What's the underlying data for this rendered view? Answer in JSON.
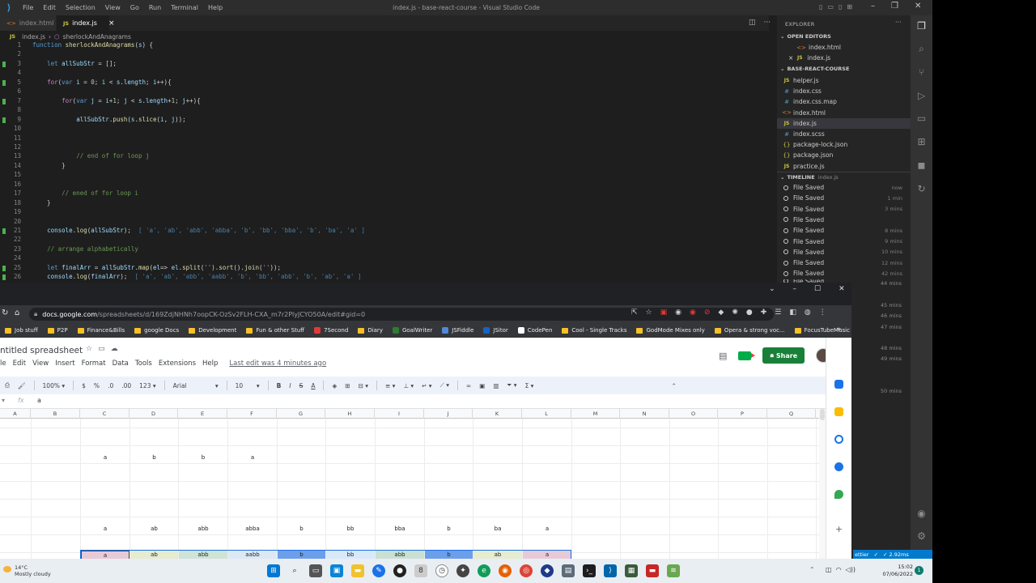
{
  "vscode": {
    "menus": [
      "File",
      "Edit",
      "Selection",
      "View",
      "Go",
      "Run",
      "Terminal",
      "Help"
    ],
    "window_title": "index.js - base-react-course - Visual Studio Code",
    "tabs": [
      {
        "label": "index.html",
        "icon": "html-file-icon",
        "active": false
      },
      {
        "label": "index.js",
        "icon": "js-file-icon",
        "active": true
      }
    ],
    "tab_close": "×",
    "breadcrumb": {
      "file": "index.js",
      "sep": "›",
      "symbol": "sherlockAndAnagrams"
    },
    "code_lines": [
      {
        "n": "1",
        "mark": false,
        "html": "<span class='kw'>function</span> <span class='fn'>sherlockAndAnagrams</span>(<span class='var'>s</span>) {"
      },
      {
        "n": "2",
        "mark": false,
        "html": ""
      },
      {
        "n": "3",
        "mark": true,
        "html": "    <span class='kw'>let</span> <span class='var'>allSubStr</span> = [];"
      },
      {
        "n": "4",
        "mark": false,
        "html": ""
      },
      {
        "n": "5",
        "mark": true,
        "html": "    <span class='kw2'>for</span>(<span class='kw'>var</span> <span class='var'>i</span> = <span class='num'>0</span>; <span class='var'>i</span> &lt; <span class='var'>s</span>.<span class='var'>length</span>; <span class='var'>i</span>++){"
      },
      {
        "n": "6",
        "mark": false,
        "html": ""
      },
      {
        "n": "7",
        "mark": true,
        "html": "        <span class='kw2'>for</span>(<span class='kw'>var</span> <span class='var'>j</span> = <span class='var'>i</span>+<span class='num'>1</span>; <span class='var'>j</span> &lt; <span class='var'>s</span>.<span class='var'>length</span>+<span class='num'>1</span>; <span class='var'>j</span>++){"
      },
      {
        "n": "8",
        "mark": false,
        "html": ""
      },
      {
        "n": "9",
        "mark": true,
        "html": "            <span class='var'>allSubStr</span>.<span class='fn'>push</span>(<span class='var'>s</span>.<span class='fn'>slice</span>(<span class='var'>i</span>, <span class='var'>j</span>));"
      },
      {
        "n": "10",
        "mark": false,
        "html": ""
      },
      {
        "n": "11",
        "mark": false,
        "html": ""
      },
      {
        "n": "12",
        "mark": false,
        "html": ""
      },
      {
        "n": "13",
        "mark": false,
        "html": "            <span class='cmt'>// end of for loop j</span>"
      },
      {
        "n": "14",
        "mark": false,
        "html": "        }"
      },
      {
        "n": "15",
        "mark": false,
        "html": ""
      },
      {
        "n": "16",
        "mark": false,
        "html": ""
      },
      {
        "n": "17",
        "mark": false,
        "html": "        <span class='cmt'>// ened of for loop i</span>"
      },
      {
        "n": "18",
        "mark": false,
        "html": "    }"
      },
      {
        "n": "19",
        "mark": false,
        "html": ""
      },
      {
        "n": "20",
        "mark": false,
        "html": ""
      },
      {
        "n": "21",
        "mark": true,
        "html": "    <span class='var'>console</span>.<span class='fn'>log</span>(<span class='var'>allSubStr</span>);  <span class='quokka'>[ 'a', 'ab', 'abb', 'abba', 'b', 'bb', 'bba', 'b', 'ba', 'a' ]</span>"
      },
      {
        "n": "22",
        "mark": false,
        "html": ""
      },
      {
        "n": "23",
        "mark": false,
        "html": "    <span class='cmt'>// arrange alphabetically</span>"
      },
      {
        "n": "24",
        "mark": false,
        "html": ""
      },
      {
        "n": "25",
        "mark": true,
        "html": "    <span class='kw'>let</span> <span class='var'>finalArr</span> = <span class='var'>allSubStr</span>.<span class='fn'>map</span>(<span class='var'>el</span>=&gt; <span class='var'>el</span>.<span class='fn'>split</span>(<span class='str'>''</span>).<span class='fn'>sort</span>().<span class='fn'>join</span>(<span class='str'>''</span>));"
      },
      {
        "n": "26",
        "mark": true,
        "html": "    <span class='var'>console</span>.<span class='fn'>log</span>(<span class='var'>finalArr</span>);  <span class='quokka'>[ 'a', 'ab', 'abb', 'aabb', 'b', 'bb', 'abb', 'b', 'ab', 'a' ]</span>"
      }
    ],
    "explorer": {
      "title": "EXPLORER",
      "more": "···",
      "open_editors_label": "OPEN EDITORS",
      "open_editors": [
        {
          "label": "index.html",
          "icon": "html-file-icon"
        },
        {
          "label": "index.js",
          "icon": "js-file-icon"
        }
      ],
      "open_close": "×",
      "project_label": "BASE-REACT-COURSE",
      "files": [
        {
          "label": "helper.js",
          "icon": "js-file-icon",
          "sel": false
        },
        {
          "label": "index.css",
          "icon": "css-file-icon",
          "sel": false
        },
        {
          "label": "index.css.map",
          "icon": "css-file-icon",
          "sel": false
        },
        {
          "label": "index.html",
          "icon": "html-file-icon",
          "sel": false
        },
        {
          "label": "index.js",
          "icon": "js-file-icon",
          "sel": true
        },
        {
          "label": "index.scss",
          "icon": "css-file-icon",
          "sel": false
        },
        {
          "label": "package-lock.json",
          "icon": "json-file-icon",
          "sel": false
        },
        {
          "label": "package.json",
          "icon": "json-file-icon",
          "sel": false
        },
        {
          "label": "practice.js",
          "icon": "js-file-icon",
          "sel": false
        }
      ],
      "timeline_label": "TIMELINE",
      "timeline_file": "index.js",
      "timeline": [
        {
          "label": "File Saved",
          "time": "now"
        },
        {
          "label": "File Saved",
          "time": "1 min"
        },
        {
          "label": "File Saved",
          "time": "3 mins"
        },
        {
          "label": "File Saved",
          "time": ""
        },
        {
          "label": "File Saved",
          "time": "8 mins"
        },
        {
          "label": "File Saved",
          "time": "9 mins"
        },
        {
          "label": "File Saved",
          "time": "10 mins"
        },
        {
          "label": "File Saved",
          "time": "12 mins"
        },
        {
          "label": "File Saved",
          "time": "42 mins"
        }
      ],
      "timeline_truncated": "File Saved",
      "timeline_extra_times": [
        "44 mins",
        "45 mins",
        "46 mins",
        "47 mins",
        "48 mins",
        "49 mins",
        "50 mins"
      ]
    },
    "statusbar": {
      "left": "ettier",
      "check": "✓",
      "timing": "✓ 2.92ms"
    }
  },
  "chrome": {
    "url_host": "docs.google.com",
    "url_path": "/spreadsheets/d/169ZdjNHNh7oopCK-OzSv2FLH-CXA_m7r2PlyJCYO50A/edit#gid=0",
    "bookmarks": [
      {
        "label": "Job stuff",
        "kind": "folder"
      },
      {
        "label": "P2P",
        "kind": "folder"
      },
      {
        "label": "Finance&Bills",
        "kind": "folder"
      },
      {
        "label": "google Docs",
        "kind": "folder"
      },
      {
        "label": "Development",
        "kind": "folder"
      },
      {
        "label": "Fun & other Stuff",
        "kind": "folder"
      },
      {
        "label": "7Second",
        "kind": "site",
        "color": "#e53935"
      },
      {
        "label": "Diary",
        "kind": "folder"
      },
      {
        "label": "GoalWriter",
        "kind": "site",
        "color": "#2e7d32"
      },
      {
        "label": "JSFiddle",
        "kind": "site",
        "color": "#4f8ad9"
      },
      {
        "label": "JSitor",
        "kind": "site",
        "color": "#1565c0"
      },
      {
        "label": "CodePen",
        "kind": "site",
        "color": "#ffffff"
      },
      {
        "label": "Cool - Single Tracks",
        "kind": "folder"
      },
      {
        "label": "GodMode Mixes only",
        "kind": "folder"
      },
      {
        "label": "Opera & strong voc...",
        "kind": "folder"
      },
      {
        "label": "FocusTubeMusic",
        "kind": "folder"
      }
    ],
    "bookmarks_more": "»"
  },
  "sheets": {
    "title": "ntitled spreadsheet",
    "menus": [
      "le",
      "Edit",
      "View",
      "Insert",
      "Format",
      "Data",
      "Tools",
      "Extensions",
      "Help"
    ],
    "last_edit": "Last edit was 4 minutes ago",
    "share_label": "Share",
    "toolbar": {
      "zoom": "100%",
      "currency": "$",
      "percent": "%",
      "dec_less": ".0",
      "dec_more": ".00",
      "format": "123",
      "font": "Arial",
      "size": "10",
      "bold": "B",
      "italic": "I",
      "strike": "S",
      "text_color": "A"
    },
    "formula_value": "a",
    "columns": [
      "A",
      "B",
      "C",
      "D",
      "E",
      "F",
      "G",
      "H",
      "I",
      "J",
      "K",
      "L",
      "M",
      "N",
      "O",
      "P",
      "Q"
    ],
    "row1": [
      "a",
      "b",
      "b",
      "a"
    ],
    "row2": [
      "a",
      "ab",
      "abb",
      "abba",
      "b",
      "bb",
      "bba",
      "b",
      "ba",
      "a"
    ],
    "row3": [
      "a",
      "ab",
      "abb",
      "aabb",
      "b",
      "bb",
      "abb",
      "b",
      "ab",
      "a"
    ],
    "row3_colors": [
      "#e8c9d8",
      "#e6ecd0",
      "#cfe3d6",
      "#dde8f5",
      "#6d9eeb",
      "#d9e8fb",
      "#c9e0d2",
      "#6d9eeb",
      "#e6ecd0",
      "#e8c9d8"
    ]
  },
  "taskbar": {
    "temp": "14°C",
    "weather": "Mostly cloudy",
    "time": "15:02",
    "date": "07/06/2022",
    "notif": "1"
  },
  "colors": {
    "vscode_bg": "#1e1e1e",
    "accent_blue": "#007acc",
    "share_green": "#188038"
  }
}
